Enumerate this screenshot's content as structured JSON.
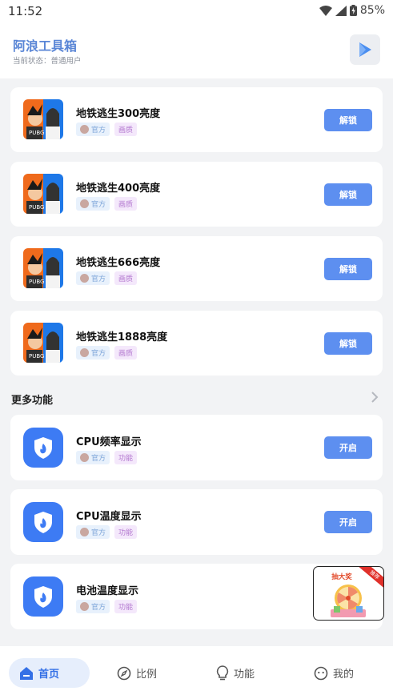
{
  "status": {
    "time": "11:52",
    "battery": "85%"
  },
  "header": {
    "title": "阿浪工具箱",
    "subtitle": "当前状态：普通用户"
  },
  "cards": [
    {
      "name": "地铁逃生300亮度",
      "tags": [
        "官方",
        "画质"
      ],
      "action": "解锁"
    },
    {
      "name": "地铁逃生400亮度",
      "tags": [
        "官方",
        "画质"
      ],
      "action": "解锁"
    },
    {
      "name": "地铁逃生666亮度",
      "tags": [
        "官方",
        "画质"
      ],
      "action": "解锁"
    },
    {
      "name": "地铁逃生1888亮度",
      "tags": [
        "官方",
        "画质"
      ],
      "action": "解锁"
    }
  ],
  "more": {
    "label": "更多功能"
  },
  "features": [
    {
      "name": "CPU频率显示",
      "tags": [
        "官方",
        "功能"
      ],
      "action": "开启"
    },
    {
      "name": "CPU温度显示",
      "tags": [
        "官方",
        "功能"
      ],
      "action": "开启"
    },
    {
      "name": "电池温度显示",
      "tags": [
        "官方",
        "功能"
      ]
    }
  ],
  "promo": {
    "title": "抽大奖",
    "badge": "推荐"
  },
  "nav": [
    {
      "label": "首页",
      "icon": "home-icon",
      "active": true
    },
    {
      "label": "比例",
      "icon": "compass-icon"
    },
    {
      "label": "功能",
      "icon": "bulb-icon"
    },
    {
      "label": "我的",
      "icon": "smile-icon"
    }
  ],
  "colors": {
    "accent": "#5d8ff0",
    "title": "#5a86d6",
    "app_icon": "#3d7bf4",
    "background": "#f2f3f5"
  }
}
